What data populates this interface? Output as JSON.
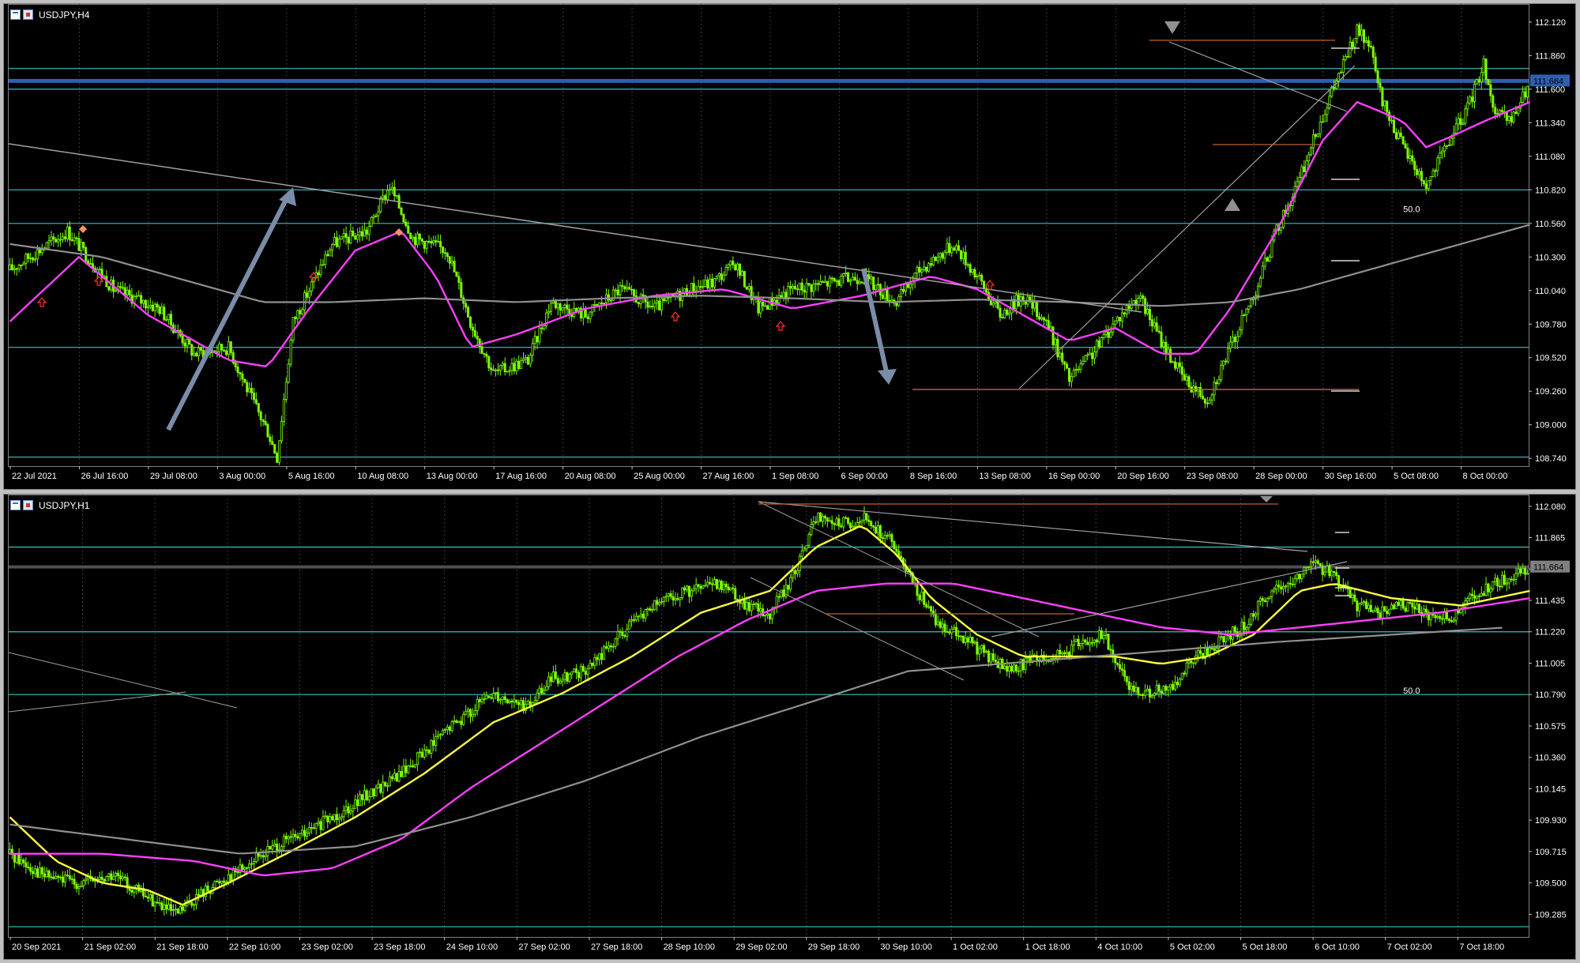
{
  "colors": {
    "background": "#000000",
    "candle": "#7cfc00",
    "grid": "#3a3a3a",
    "axis_text": "#ffffff",
    "hline": "#40c0c0",
    "price_line_upper": "#2f5fb0",
    "price_line_lower": "#505050",
    "ma_magenta": "#ff40ff",
    "ma_gray": "#909090",
    "ma_yellow": "#ffff40",
    "trendline": "#a0a0a0",
    "arrow": "#7a8ca8",
    "level_orange": "#c06030",
    "marker_red": "#ff3030"
  },
  "windows": [
    {
      "id": "h4",
      "title": "USDJPY,H4",
      "icon": "chart-window-icon",
      "current_price": "111.664",
      "fibo_label": "50.0",
      "price_labels": [
        "112.120",
        "111.860",
        "111.600",
        "111.340",
        "111.080",
        "110.820",
        "110.560",
        "110.300",
        "110.040",
        "109.780",
        "109.520",
        "109.260",
        "109.000",
        "108.740"
      ],
      "time_labels": [
        "22 Jul 2021",
        "26 Jul 16:00",
        "29 Jul 08:00",
        "3 Aug 00:00",
        "5 Aug 16:00",
        "10 Aug 08:00",
        "13 Aug 00:00",
        "17 Aug 16:00",
        "20 Aug 08:00",
        "25 Aug 00:00",
        "27 Aug 16:00",
        "1 Sep 08:00",
        "6 Sep 00:00",
        "8 Sep 16:00",
        "13 Sep 08:00",
        "16 Sep 00:00",
        "20 Sep 16:00",
        "23 Sep 08:00",
        "28 Sep 00:00",
        "30 Sep 16:00",
        "5 Oct 08:00",
        "8 Oct 00:00"
      ],
      "hlines": [
        111.76,
        111.6,
        110.82,
        110.56,
        109.6,
        108.75
      ],
      "chart_data": {
        "type": "candlestick",
        "symbol": "USDJPY",
        "timeframe": "H4",
        "ylim": [
          108.68,
          112.26
        ],
        "x_range": [
          "22 Jul 2021",
          "8 Oct 2021"
        ],
        "current_price": 111.664,
        "horizontal_levels": [
          111.76,
          111.6,
          110.82,
          110.56,
          109.6,
          108.75
        ],
        "close_path": [
          [
            0,
            110.2
          ],
          [
            25,
            110.5
          ],
          [
            45,
            110.05
          ],
          [
            65,
            109.9
          ],
          [
            80,
            109.55
          ],
          [
            95,
            109.6
          ],
          [
            105,
            109.2
          ],
          [
            112,
            108.95
          ],
          [
            116,
            108.75
          ],
          [
            123,
            109.8
          ],
          [
            140,
            110.4
          ],
          [
            155,
            110.5
          ],
          [
            165,
            110.85
          ],
          [
            175,
            110.45
          ],
          [
            190,
            110.35
          ],
          [
            200,
            109.8
          ],
          [
            210,
            109.4
          ],
          [
            225,
            109.5
          ],
          [
            235,
            109.95
          ],
          [
            250,
            109.85
          ],
          [
            265,
            110.05
          ],
          [
            280,
            109.9
          ],
          [
            295,
            110.05
          ],
          [
            305,
            110.1
          ],
          [
            315,
            110.25
          ],
          [
            325,
            109.9
          ],
          [
            340,
            110.05
          ],
          [
            355,
            110.1
          ],
          [
            370,
            110.15
          ],
          [
            385,
            109.95
          ],
          [
            395,
            110.2
          ],
          [
            410,
            110.4
          ],
          [
            420,
            110.15
          ],
          [
            430,
            109.85
          ],
          [
            440,
            110.0
          ],
          [
            450,
            109.8
          ],
          [
            460,
            109.35
          ],
          [
            470,
            109.55
          ],
          [
            480,
            109.8
          ],
          [
            490,
            110.0
          ],
          [
            500,
            109.65
          ],
          [
            510,
            109.35
          ],
          [
            520,
            109.2
          ],
          [
            530,
            109.6
          ],
          [
            540,
            110.0
          ],
          [
            550,
            110.5
          ],
          [
            560,
            110.9
          ],
          [
            570,
            111.4
          ],
          [
            578,
            111.75
          ],
          [
            585,
            112.05
          ],
          [
            590,
            111.95
          ],
          [
            596,
            111.5
          ],
          [
            605,
            111.15
          ],
          [
            615,
            110.85
          ],
          [
            625,
            111.2
          ],
          [
            633,
            111.45
          ],
          [
            640,
            111.8
          ],
          [
            645,
            111.4
          ],
          [
            652,
            111.35
          ],
          [
            660,
            111.65
          ]
        ],
        "moving_averages": {
          "magenta": [
            [
              0,
              109.8
            ],
            [
              30,
              110.3
            ],
            [
              60,
              109.85
            ],
            [
              95,
              109.5
            ],
            [
              112,
              109.45
            ],
            [
              130,
              109.9
            ],
            [
              150,
              110.35
            ],
            [
              170,
              110.5
            ],
            [
              185,
              110.15
            ],
            [
              200,
              109.6
            ],
            [
              220,
              109.7
            ],
            [
              250,
              109.9
            ],
            [
              280,
              110.0
            ],
            [
              310,
              110.05
            ],
            [
              340,
              109.9
            ],
            [
              370,
              110.0
            ],
            [
              400,
              110.15
            ],
            [
              420,
              110.05
            ],
            [
              440,
              109.85
            ],
            [
              460,
              109.65
            ],
            [
              480,
              109.75
            ],
            [
              500,
              109.55
            ],
            [
              515,
              109.55
            ],
            [
              530,
              109.9
            ],
            [
              550,
              110.5
            ],
            [
              570,
              111.2
            ],
            [
              585,
              111.5
            ],
            [
              592,
              111.45
            ],
            [
              605,
              111.35
            ],
            [
              615,
              111.15
            ],
            [
              628,
              111.25
            ],
            [
              640,
              111.35
            ],
            [
              660,
              111.5
            ]
          ],
          "gray": [
            [
              0,
              110.4
            ],
            [
              40,
              110.3
            ],
            [
              80,
              110.1
            ],
            [
              110,
              109.95
            ],
            [
              140,
              109.95
            ],
            [
              180,
              109.98
            ],
            [
              220,
              109.95
            ],
            [
              260,
              109.98
            ],
            [
              300,
              110.0
            ],
            [
              340,
              109.98
            ],
            [
              380,
              109.95
            ],
            [
              420,
              109.97
            ],
            [
              460,
              109.95
            ],
            [
              500,
              109.92
            ],
            [
              530,
              109.95
            ],
            [
              560,
              110.05
            ],
            [
              590,
              110.2
            ],
            [
              620,
              110.35
            ],
            [
              650,
              110.5
            ],
            [
              660,
              110.55
            ]
          ]
        },
        "annotations": [
          "down-triangle at 112.1",
          "up-triangle at 110.8",
          "arrow up from 108.75 to 110.82",
          "arrow down from 110.3 to 109.15"
        ]
      }
    },
    {
      "id": "h1",
      "title": "USDJPY,H1",
      "icon": "chart-window-icon",
      "current_price": "111.664",
      "fibo_label": "50.0",
      "price_labels": [
        "112.080",
        "111.865",
        "111.650",
        "111.435",
        "111.220",
        "111.005",
        "110.790",
        "110.575",
        "110.360",
        "110.145",
        "109.930",
        "109.715",
        "109.500",
        "109.285"
      ],
      "time_labels": [
        "20 Sep 2021",
        "21 Sep 02:00",
        "21 Sep 18:00",
        "22 Sep 10:00",
        "23 Sep 02:00",
        "23 Sep 18:00",
        "24 Sep 10:00",
        "27 Sep 02:00",
        "27 Sep 18:00",
        "28 Sep 10:00",
        "29 Sep 02:00",
        "29 Sep 18:00",
        "30 Sep 10:00",
        "1 Oct 02:00",
        "1 Oct 18:00",
        "4 Oct 10:00",
        "5 Oct 02:00",
        "5 Oct 18:00",
        "6 Oct 10:00",
        "7 Oct 02:00",
        "7 Oct 18:00"
      ],
      "hlines": [
        111.8,
        111.664,
        111.22,
        110.79,
        109.2
      ],
      "chart_data": {
        "type": "candlestick",
        "symbol": "USDJPY",
        "timeframe": "H1",
        "ylim": [
          109.13,
          112.16
        ],
        "x_range": [
          "20 Sep 2021",
          "7 Oct 2021"
        ],
        "current_price": 111.664,
        "horizontal_levels": [
          111.8,
          111.664,
          111.22,
          110.79,
          109.2
        ],
        "close_path": [
          [
            0,
            109.7
          ],
          [
            15,
            109.55
          ],
          [
            30,
            109.5
          ],
          [
            45,
            109.55
          ],
          [
            60,
            109.4
          ],
          [
            72,
            109.28
          ],
          [
            85,
            109.45
          ],
          [
            100,
            109.6
          ],
          [
            115,
            109.75
          ],
          [
            130,
            109.85
          ],
          [
            150,
            110.05
          ],
          [
            170,
            110.25
          ],
          [
            190,
            110.55
          ],
          [
            210,
            110.8
          ],
          [
            225,
            110.7
          ],
          [
            235,
            110.9
          ],
          [
            250,
            110.95
          ],
          [
            265,
            111.2
          ],
          [
            280,
            111.4
          ],
          [
            295,
            111.5
          ],
          [
            310,
            111.55
          ],
          [
            320,
            111.4
          ],
          [
            330,
            111.35
          ],
          [
            340,
            111.6
          ],
          [
            350,
            112.0
          ],
          [
            360,
            111.95
          ],
          [
            370,
            112.0
          ],
          [
            382,
            111.85
          ],
          [
            392,
            111.55
          ],
          [
            402,
            111.3
          ],
          [
            412,
            111.2
          ],
          [
            425,
            111.05
          ],
          [
            435,
            110.95
          ],
          [
            445,
            111.05
          ],
          [
            455,
            111.05
          ],
          [
            465,
            111.15
          ],
          [
            475,
            111.2
          ],
          [
            485,
            110.85
          ],
          [
            495,
            110.8
          ],
          [
            505,
            110.85
          ],
          [
            515,
            111.05
          ],
          [
            525,
            111.15
          ],
          [
            535,
            111.25
          ],
          [
            545,
            111.45
          ],
          [
            555,
            111.55
          ],
          [
            565,
            111.7
          ],
          [
            575,
            111.6
          ],
          [
            585,
            111.4
          ],
          [
            595,
            111.35
          ],
          [
            605,
            111.4
          ],
          [
            615,
            111.35
          ],
          [
            625,
            111.3
          ],
          [
            635,
            111.45
          ],
          [
            645,
            111.55
          ],
          [
            660,
            111.66
          ]
        ],
        "moving_averages": {
          "yellow": [
            [
              0,
              109.95
            ],
            [
              20,
              109.65
            ],
            [
              40,
              109.5
            ],
            [
              60,
              109.45
            ],
            [
              75,
              109.35
            ],
            [
              95,
              109.5
            ],
            [
              120,
              109.7
            ],
            [
              150,
              109.95
            ],
            [
              180,
              110.25
            ],
            [
              210,
              110.6
            ],
            [
              240,
              110.8
            ],
            [
              270,
              111.05
            ],
            [
              300,
              111.35
            ],
            [
              330,
              111.5
            ],
            [
              350,
              111.8
            ],
            [
              370,
              111.95
            ],
            [
              385,
              111.75
            ],
            [
              400,
              111.45
            ],
            [
              420,
              111.2
            ],
            [
              440,
              111.05
            ],
            [
              460,
              111.05
            ],
            [
              480,
              111.05
            ],
            [
              500,
              111.0
            ],
            [
              520,
              111.05
            ],
            [
              540,
              111.2
            ],
            [
              560,
              111.5
            ],
            [
              575,
              111.55
            ],
            [
              600,
              111.45
            ],
            [
              630,
              111.4
            ],
            [
              660,
              111.5
            ]
          ],
          "magenta": [
            [
              0,
              109.7
            ],
            [
              40,
              109.7
            ],
            [
              80,
              109.65
            ],
            [
              110,
              109.55
            ],
            [
              140,
              109.6
            ],
            [
              170,
              109.8
            ],
            [
              200,
              110.15
            ],
            [
              230,
              110.45
            ],
            [
              260,
              110.75
            ],
            [
              290,
              111.05
            ],
            [
              320,
              111.3
            ],
            [
              350,
              111.5
            ],
            [
              380,
              111.55
            ],
            [
              410,
              111.55
            ],
            [
              440,
              111.45
            ],
            [
              470,
              111.35
            ],
            [
              500,
              111.25
            ],
            [
              530,
              111.2
            ],
            [
              560,
              111.25
            ],
            [
              590,
              111.3
            ],
            [
              620,
              111.35
            ],
            [
              660,
              111.45
            ]
          ],
          "gray": [
            [
              0,
              109.9
            ],
            [
              50,
              109.8
            ],
            [
              100,
              109.7
            ],
            [
              150,
              109.75
            ],
            [
              200,
              109.95
            ],
            [
              250,
              110.2
            ],
            [
              300,
              110.5
            ],
            [
              350,
              110.75
            ],
            [
              390,
              110.95
            ],
            [
              430,
              111.0
            ],
            [
              470,
              111.05
            ],
            [
              510,
              111.1
            ],
            [
              550,
              111.15
            ],
            [
              600,
              111.2
            ],
            [
              650,
              111.25
            ]
          ]
        }
      }
    }
  ]
}
